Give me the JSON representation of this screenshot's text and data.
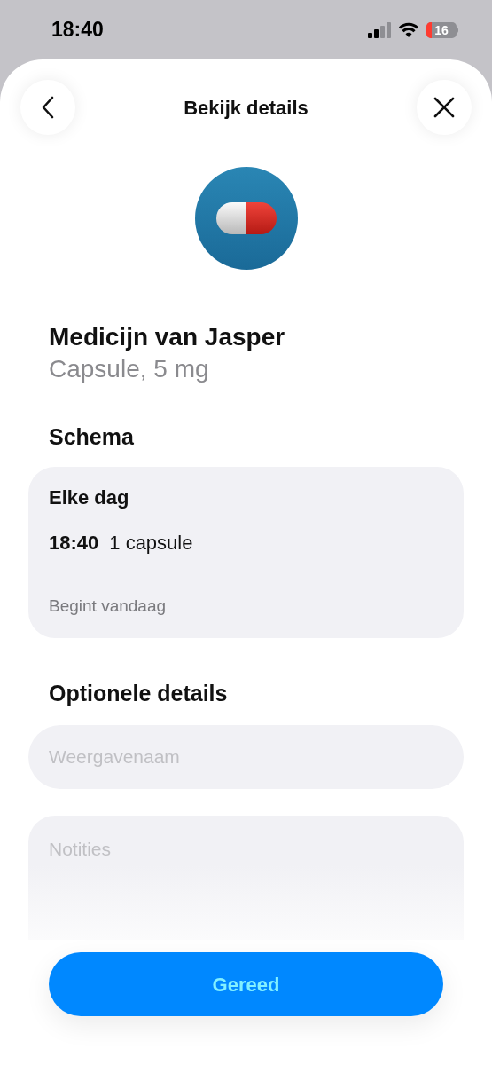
{
  "status_bar": {
    "time": "18:40",
    "battery": "16"
  },
  "header": {
    "title": "Bekijk details"
  },
  "medication": {
    "name": "Medicijn van Jasper",
    "form": "Capsule, 5 mg"
  },
  "schedule": {
    "heading": "Schema",
    "frequency": "Elke dag",
    "doses": [
      {
        "time": "18:40",
        "amount": "1 capsule"
      }
    ],
    "start": "Begint vandaag"
  },
  "optional": {
    "heading": "Optionele details",
    "fields": [
      {
        "kind": "line",
        "placeholder": "Weergavenaam"
      },
      {
        "kind": "area",
        "placeholder": "Notities"
      }
    ]
  },
  "primary_button": "Gereed"
}
